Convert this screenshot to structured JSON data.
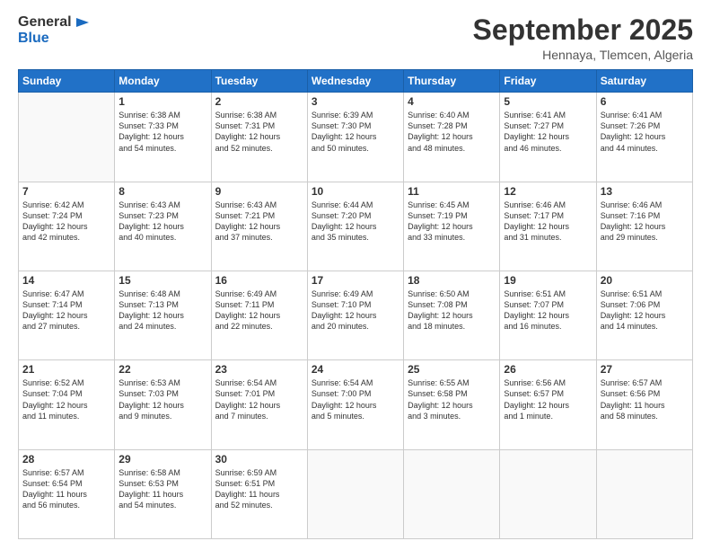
{
  "logo": {
    "line1": "General",
    "line2": "Blue"
  },
  "header": {
    "month": "September 2025",
    "location": "Hennaya, Tlemcen, Algeria"
  },
  "weekdays": [
    "Sunday",
    "Monday",
    "Tuesday",
    "Wednesday",
    "Thursday",
    "Friday",
    "Saturday"
  ],
  "weeks": [
    [
      {
        "day": "",
        "text": ""
      },
      {
        "day": "1",
        "text": "Sunrise: 6:38 AM\nSunset: 7:33 PM\nDaylight: 12 hours\nand 54 minutes."
      },
      {
        "day": "2",
        "text": "Sunrise: 6:38 AM\nSunset: 7:31 PM\nDaylight: 12 hours\nand 52 minutes."
      },
      {
        "day": "3",
        "text": "Sunrise: 6:39 AM\nSunset: 7:30 PM\nDaylight: 12 hours\nand 50 minutes."
      },
      {
        "day": "4",
        "text": "Sunrise: 6:40 AM\nSunset: 7:28 PM\nDaylight: 12 hours\nand 48 minutes."
      },
      {
        "day": "5",
        "text": "Sunrise: 6:41 AM\nSunset: 7:27 PM\nDaylight: 12 hours\nand 46 minutes."
      },
      {
        "day": "6",
        "text": "Sunrise: 6:41 AM\nSunset: 7:26 PM\nDaylight: 12 hours\nand 44 minutes."
      }
    ],
    [
      {
        "day": "7",
        "text": "Sunrise: 6:42 AM\nSunset: 7:24 PM\nDaylight: 12 hours\nand 42 minutes."
      },
      {
        "day": "8",
        "text": "Sunrise: 6:43 AM\nSunset: 7:23 PM\nDaylight: 12 hours\nand 40 minutes."
      },
      {
        "day": "9",
        "text": "Sunrise: 6:43 AM\nSunset: 7:21 PM\nDaylight: 12 hours\nand 37 minutes."
      },
      {
        "day": "10",
        "text": "Sunrise: 6:44 AM\nSunset: 7:20 PM\nDaylight: 12 hours\nand 35 minutes."
      },
      {
        "day": "11",
        "text": "Sunrise: 6:45 AM\nSunset: 7:19 PM\nDaylight: 12 hours\nand 33 minutes."
      },
      {
        "day": "12",
        "text": "Sunrise: 6:46 AM\nSunset: 7:17 PM\nDaylight: 12 hours\nand 31 minutes."
      },
      {
        "day": "13",
        "text": "Sunrise: 6:46 AM\nSunset: 7:16 PM\nDaylight: 12 hours\nand 29 minutes."
      }
    ],
    [
      {
        "day": "14",
        "text": "Sunrise: 6:47 AM\nSunset: 7:14 PM\nDaylight: 12 hours\nand 27 minutes."
      },
      {
        "day": "15",
        "text": "Sunrise: 6:48 AM\nSunset: 7:13 PM\nDaylight: 12 hours\nand 24 minutes."
      },
      {
        "day": "16",
        "text": "Sunrise: 6:49 AM\nSunset: 7:11 PM\nDaylight: 12 hours\nand 22 minutes."
      },
      {
        "day": "17",
        "text": "Sunrise: 6:49 AM\nSunset: 7:10 PM\nDaylight: 12 hours\nand 20 minutes."
      },
      {
        "day": "18",
        "text": "Sunrise: 6:50 AM\nSunset: 7:08 PM\nDaylight: 12 hours\nand 18 minutes."
      },
      {
        "day": "19",
        "text": "Sunrise: 6:51 AM\nSunset: 7:07 PM\nDaylight: 12 hours\nand 16 minutes."
      },
      {
        "day": "20",
        "text": "Sunrise: 6:51 AM\nSunset: 7:06 PM\nDaylight: 12 hours\nand 14 minutes."
      }
    ],
    [
      {
        "day": "21",
        "text": "Sunrise: 6:52 AM\nSunset: 7:04 PM\nDaylight: 12 hours\nand 11 minutes."
      },
      {
        "day": "22",
        "text": "Sunrise: 6:53 AM\nSunset: 7:03 PM\nDaylight: 12 hours\nand 9 minutes."
      },
      {
        "day": "23",
        "text": "Sunrise: 6:54 AM\nSunset: 7:01 PM\nDaylight: 12 hours\nand 7 minutes."
      },
      {
        "day": "24",
        "text": "Sunrise: 6:54 AM\nSunset: 7:00 PM\nDaylight: 12 hours\nand 5 minutes."
      },
      {
        "day": "25",
        "text": "Sunrise: 6:55 AM\nSunset: 6:58 PM\nDaylight: 12 hours\nand 3 minutes."
      },
      {
        "day": "26",
        "text": "Sunrise: 6:56 AM\nSunset: 6:57 PM\nDaylight: 12 hours\nand 1 minute."
      },
      {
        "day": "27",
        "text": "Sunrise: 6:57 AM\nSunset: 6:56 PM\nDaylight: 11 hours\nand 58 minutes."
      }
    ],
    [
      {
        "day": "28",
        "text": "Sunrise: 6:57 AM\nSunset: 6:54 PM\nDaylight: 11 hours\nand 56 minutes."
      },
      {
        "day": "29",
        "text": "Sunrise: 6:58 AM\nSunset: 6:53 PM\nDaylight: 11 hours\nand 54 minutes."
      },
      {
        "day": "30",
        "text": "Sunrise: 6:59 AM\nSunset: 6:51 PM\nDaylight: 11 hours\nand 52 minutes."
      },
      {
        "day": "",
        "text": ""
      },
      {
        "day": "",
        "text": ""
      },
      {
        "day": "",
        "text": ""
      },
      {
        "day": "",
        "text": ""
      }
    ]
  ]
}
